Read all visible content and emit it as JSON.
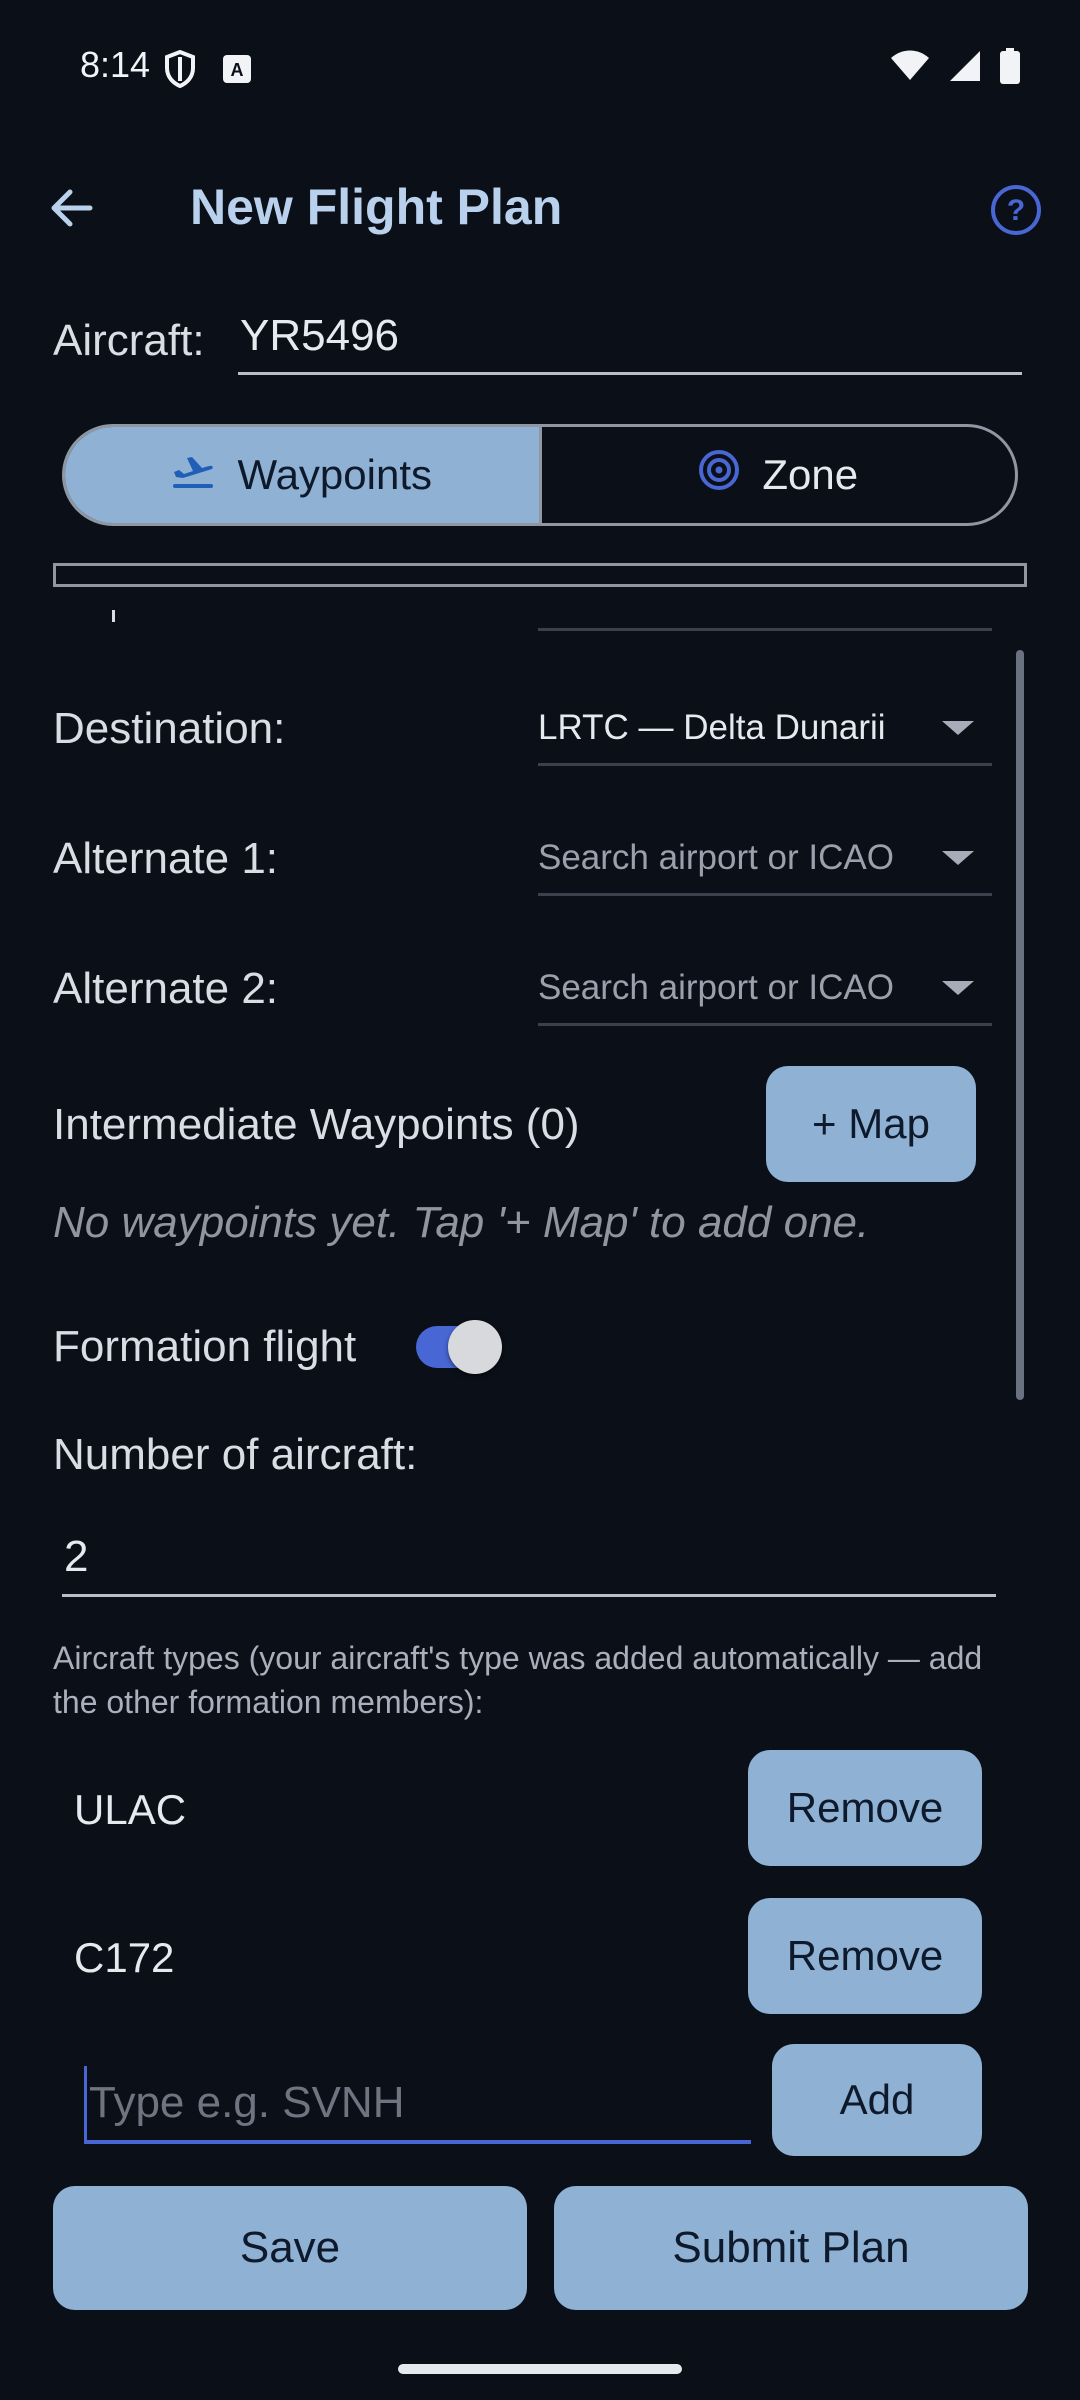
{
  "status": {
    "time": "8:14"
  },
  "header": {
    "title": "New Flight Plan"
  },
  "aircraft": {
    "label": "Aircraft:",
    "value": "YR5496"
  },
  "mode_tabs": {
    "waypoints": "Waypoints",
    "zone": "Zone"
  },
  "route": {
    "destination_label": "Destination:",
    "destination_value": "LRTC — Delta Dunarii",
    "alternate1_label": "Alternate 1:",
    "alternate1_placeholder": "Search airport or ICAO",
    "alternate2_label": "Alternate 2:",
    "alternate2_placeholder": "Search airport or ICAO"
  },
  "waypoints": {
    "title": "Intermediate Waypoints (0)",
    "map_button": "+ Map",
    "empty_hint": "No waypoints yet. Tap '+ Map' to add one."
  },
  "formation": {
    "label": "Formation flight",
    "enabled": true,
    "count_label": "Number of aircraft:",
    "count_value": "2",
    "types_note": "Aircraft types (your aircraft's type was added automatically — add the other formation members):",
    "types": [
      {
        "name": "ULAC",
        "remove": "Remove"
      },
      {
        "name": "C172",
        "remove": "Remove"
      }
    ],
    "type_placeholder": "Type e.g. SVNH",
    "add_button": "Add"
  },
  "footer": {
    "save": "Save",
    "submit": "Submit Plan"
  },
  "colors": {
    "accent": "#4867d4",
    "button": "#8fb1d4",
    "background": "#0a0f18",
    "title": "#b9d1ec"
  }
}
